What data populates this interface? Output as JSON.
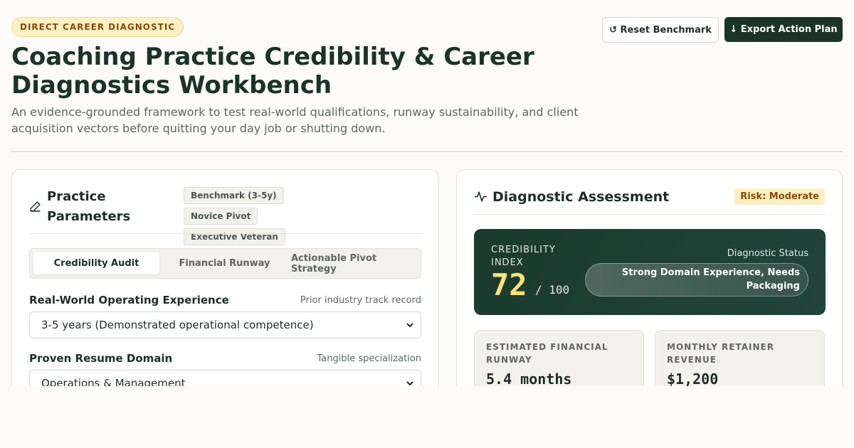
{
  "header": {
    "badge": "DIRECT CAREER DIAGNOSTIC",
    "title": "Coaching Practice Credibility & Career Diagnostics Workbench",
    "subtitle": "An evidence-grounded framework to test real-world qualifications, runway sustainability, and client acquisition vectors before quitting your day job or shutting down.",
    "reset_label": "↺ Reset Benchmark",
    "export_label": "↓ Export Action Plan"
  },
  "parameters": {
    "title": "Practice Parameters",
    "presets": [
      "Benchmark (3-5y)",
      "Novice Pivot",
      "Executive Veteran"
    ],
    "tabs": [
      "Credibility Audit",
      "Financial Runway",
      "Actionable Pivot Strategy"
    ],
    "active_tab": "Credibility Audit",
    "fields": [
      {
        "label": "Real-World Operating Experience",
        "hint": "Prior industry track record",
        "value": "3-5 years (Demonstrated operational competence)"
      },
      {
        "label": "Proven Resume Domain",
        "hint": "Tangible specialization",
        "value": "Operations & Management"
      }
    ]
  },
  "assessment": {
    "title": "Diagnostic Assessment",
    "risk": "Risk: Moderate",
    "index_label": "CREDIBILITY INDEX",
    "index_value": "72",
    "index_denominator": "/ 100",
    "status_label": "Diagnostic Status",
    "status_value": "Strong Domain Experience, Needs Packaging",
    "stats": [
      {
        "label": "ESTIMATED FINANCIAL RUNWAY",
        "value": "5.4 months"
      },
      {
        "label": "MONTHLY RETAINER REVENUE",
        "value": "$1,200"
      }
    ]
  },
  "colors": {
    "accent_dark": "#1b3328",
    "highlight": "#f8e27a",
    "warning_bg": "#fdf0c2"
  }
}
